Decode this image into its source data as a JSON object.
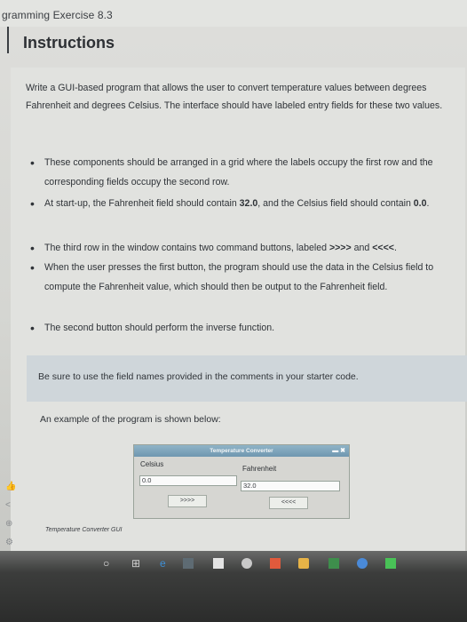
{
  "page": {
    "course_title": "gramming Exercise 8.3",
    "heading": "Instructions"
  },
  "instructions": {
    "intro": "Write a GUI-based program that allows the user to convert temperature values between degrees Fahrenheit and degrees Celsius. The interface should have labeled entry fields for these two values.",
    "bullets": [
      {
        "text": "These components should be arranged in a grid where the labels occupy the first row and the corresponding fields occupy the second row."
      },
      {
        "pre": "At start-up, the Fahrenheit field should contain ",
        "bold1": "32.0",
        "mid": ", and the Celsius field should contain ",
        "bold2": "0.0",
        "post": "."
      },
      {
        "pre": "The third row in the window contains two command buttons, labeled ",
        "bold1": ">>>>",
        "mid": " and ",
        "bold2": "<<<<",
        "post": "."
      },
      {
        "text": "When the user presses the first button, the program should use the data in the Celsius field to compute the Fahrenheit value, which should then be output to the Fahrenheit field."
      },
      {
        "text": "The second button should perform the inverse function."
      }
    ],
    "note": "Be sure to use the field names provided in the comments in your starter code.",
    "example_label": "An example of the program is shown below:"
  },
  "gui_example": {
    "window_title": "Temperature Converter",
    "title_buttons": "▬ ✖",
    "celsius_label": "Celsius",
    "fahrenheit_label": "Fahrenheit",
    "celsius_value": "0.0",
    "fahrenheit_value": "32.0",
    "to_fahrenheit_button": ">>>>",
    "to_celsius_button": "<<<<",
    "caption": "Temperature Converter GUI"
  },
  "icons": {
    "sidebar": [
      "thumbs-up-icon",
      "share-icon",
      "help-icon",
      "settings-icon"
    ],
    "taskbar": [
      "start-circle-icon",
      "task-view-icon",
      "edge-icon",
      "store-icon",
      "office-icon",
      "files-icon",
      "app-icon",
      "app-icon-2",
      "app-icon-3",
      "chrome-icon",
      "app-icon-4"
    ]
  },
  "colors": {
    "title_bar": "#7aa0b8",
    "note_box": "#cfd6da",
    "taskbar": "#2b2c2b"
  }
}
